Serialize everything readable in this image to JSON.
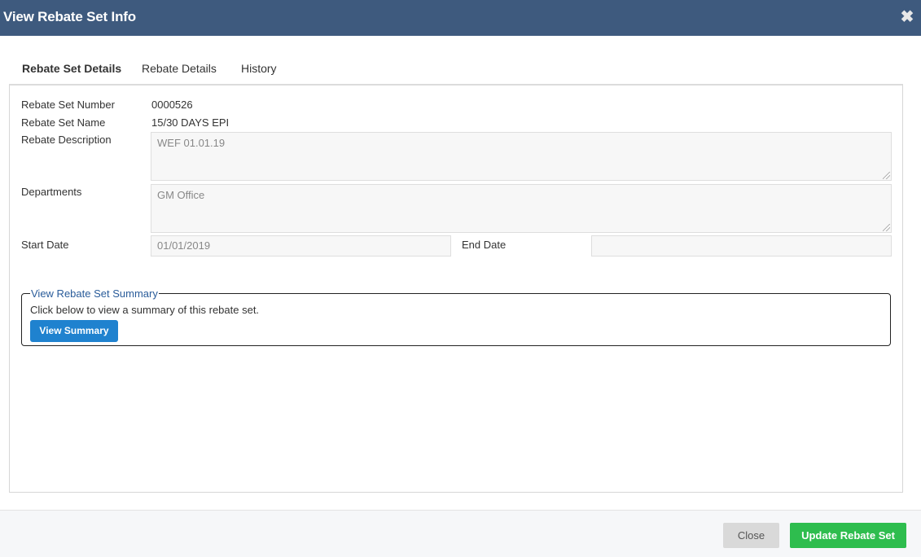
{
  "dialog": {
    "title": "View Rebate Set Info",
    "close_icon": "close-icon"
  },
  "tabs": [
    {
      "label": "Rebate Set Details",
      "active": true
    },
    {
      "label": "Rebate Details",
      "active": false
    },
    {
      "label": "History",
      "active": false
    }
  ],
  "details": {
    "rebate_set_number_label": "Rebate Set Number",
    "rebate_set_number": "0000526",
    "rebate_set_name_label": "Rebate Set Name",
    "rebate_set_name": "15/30 DAYS EPI",
    "rebate_description_label": "Rebate Description",
    "rebate_description": "WEF 01.01.19",
    "departments_label": "Departments",
    "departments": "GM Office",
    "start_date_label": "Start Date",
    "start_date": "01/01/2019",
    "end_date_label": "End Date",
    "end_date": ""
  },
  "summary": {
    "legend": "View Rebate Set Summary",
    "text": "Click below to view a summary of this rebate set.",
    "button": "View Summary"
  },
  "footer": {
    "close_label": "Close",
    "update_label": "Update Rebate Set"
  }
}
